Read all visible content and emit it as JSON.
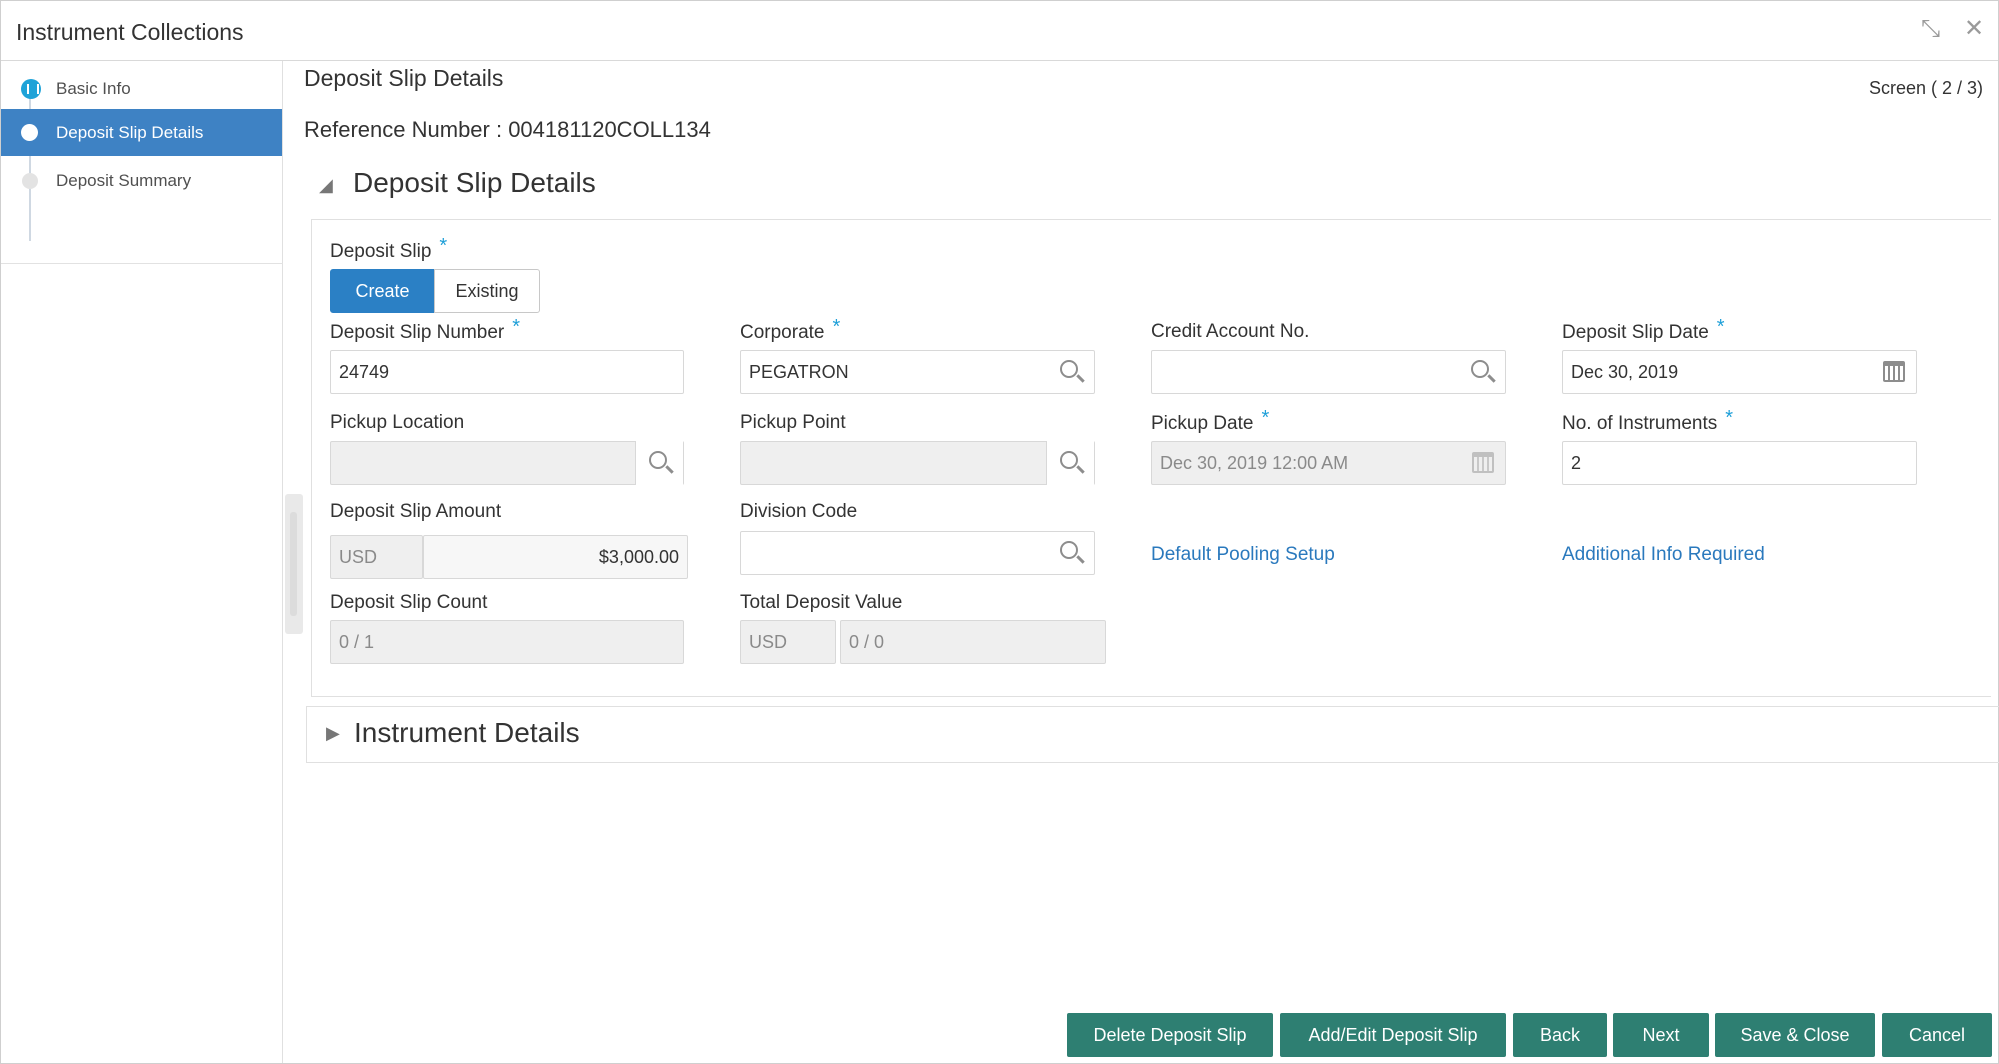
{
  "window": {
    "title": "Instrument Collections"
  },
  "sidebar": {
    "steps": [
      {
        "label": "Basic Info"
      },
      {
        "label": "Deposit Slip Details"
      },
      {
        "label": "Deposit Summary"
      }
    ]
  },
  "main": {
    "page_title": "Deposit Slip Details",
    "screen_indicator": "Screen ( 2 / 3)",
    "reference": "Reference Number : 004181120COLL134"
  },
  "section_deposit": {
    "title": "Deposit Slip Details",
    "deposit_slip": {
      "label": "Deposit Slip",
      "options": [
        "Create",
        "Existing"
      ],
      "selected": "Create"
    },
    "fields": {
      "deposit_slip_number": {
        "label": "Deposit Slip Number",
        "value": "24749"
      },
      "corporate": {
        "label": "Corporate",
        "value": "PEGATRON"
      },
      "credit_account_no": {
        "label": "Credit Account No.",
        "value": ""
      },
      "deposit_slip_date": {
        "label": "Deposit Slip Date",
        "value": "Dec 30, 2019"
      },
      "pickup_location": {
        "label": "Pickup Location",
        "value": ""
      },
      "pickup_point": {
        "label": "Pickup Point",
        "value": ""
      },
      "pickup_date": {
        "label": "Pickup Date",
        "value": "Dec 30, 2019 12:00 AM"
      },
      "no_of_instruments": {
        "label": "No. of Instruments",
        "value": "2"
      },
      "deposit_slip_amount": {
        "label": "Deposit Slip Amount",
        "currency": "USD",
        "value": "$3,000.00"
      },
      "division_code": {
        "label": "Division Code",
        "value": ""
      },
      "deposit_slip_count": {
        "label": "Deposit Slip Count",
        "value": "0 / 1"
      },
      "total_deposit_value": {
        "label": "Total Deposit Value",
        "currency": "USD",
        "value": "0 / 0"
      }
    },
    "links": {
      "default_pooling": "Default Pooling Setup",
      "additional_info": "Additional Info Required"
    }
  },
  "section_instruments": {
    "title": "Instrument Details"
  },
  "footer": {
    "delete_deposit_slip": "Delete Deposit Slip",
    "add_edit_deposit_slip": "Add/Edit Deposit Slip",
    "back": "Back",
    "next": "Next",
    "save_close": "Save & Close",
    "cancel": "Cancel"
  },
  "colors": {
    "primary": "#2b80c5",
    "active_step": "#3e82c4",
    "footer_button": "#2e7f72",
    "required": "#1e9fd8",
    "link": "#2a79bd"
  }
}
